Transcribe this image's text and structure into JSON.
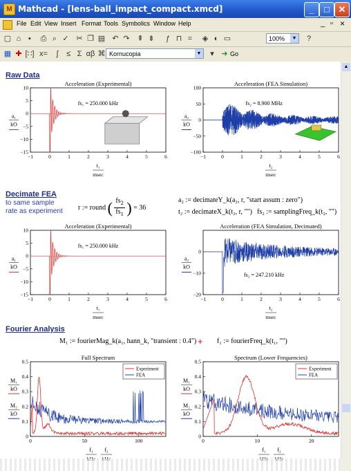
{
  "window": {
    "title": "Mathcad - [lens-ball_impact_compact.xmcd]",
    "minimize": "_",
    "maximize": "□",
    "close": "✕",
    "doc_min": "_",
    "doc_max": "▫",
    "doc_close": "×"
  },
  "menu": [
    "File",
    "Edit",
    "View",
    "Insert",
    "Format",
    "Tools",
    "Symbolics",
    "Window",
    "Help"
  ],
  "toolbar": {
    "zoom": "100%",
    "font": "Kornucopia",
    "go": "Go"
  },
  "sections": {
    "raw": "Raw Data",
    "decimate": "Decimate FEA",
    "decimate_note": [
      "to same sample",
      "rate as experiment"
    ],
    "fourier": "Fourier Analysis"
  },
  "equations": {
    "r": "r := round",
    "r_num": "fs",
    "r_num_sub": "2",
    "r_den": "fs",
    "r_den_sub": "1",
    "r_val": "= 36",
    "a2": "a₂ := decimateY_k(a₂, r, \"start assum : zero\")",
    "t2": "t₂ := decimateX_k(t₂, r, \"\")",
    "fs2": "fs₂ := samplingFreq_k(t₂, \"\")",
    "M1": "M₁ := fourierMag_k(a₁, hann_k, \"transient : 0.4\")",
    "plus": "+",
    "f1": "f₁ := fourierFreq_k(t₁, \"\")"
  },
  "chart_data": [
    {
      "type": "line",
      "title": "Acceleration (Experimental)",
      "ylabel": "a₁ / kO",
      "xlabel": "t₁ / msec",
      "xlim": [
        -1,
        6
      ],
      "ylim": [
        -15,
        10
      ],
      "xticks": [
        "−1",
        "0",
        "1",
        "2",
        "3",
        "4",
        "5",
        "6"
      ],
      "yticks": [
        "10",
        "5",
        "0",
        "−5",
        "−10",
        "−15"
      ],
      "annotation": "fs₁ = 250.000 kHz",
      "series": [
        {
          "color": "#e03030",
          "kind": "experiment_impact"
        }
      ]
    },
    {
      "type": "line",
      "title": "Acceleration (FEA Simulation)",
      "ylabel": "a₂ / kO",
      "xlabel": "t₂ / msec",
      "xlim": [
        -1,
        6
      ],
      "ylim": [
        -100,
        100
      ],
      "xticks": [
        "−1",
        "0",
        "1",
        "2",
        "3",
        "4",
        "5",
        "6"
      ],
      "yticks": [
        "100",
        "50",
        "0",
        "−50",
        "−100"
      ],
      "annotation": "fs₂ = 8.900 MHz",
      "series": [
        {
          "color": "#1f3fa8",
          "kind": "fea_noisy"
        }
      ]
    },
    {
      "type": "line",
      "title": "Acceleration (Experimental)",
      "ylabel": "a₁ / kO",
      "xlabel": "t₁ / msec",
      "xlim": [
        -1,
        6
      ],
      "ylim": [
        -15,
        10
      ],
      "xticks": [
        "−1",
        "0",
        "1",
        "2",
        "3",
        "4",
        "5",
        "6"
      ],
      "yticks": [
        "10",
        "5",
        "0",
        "−5",
        "−10",
        "−15"
      ],
      "annotation": "fs₁ = 250.000 kHz",
      "series": [
        {
          "color": "#e03030",
          "kind": "experiment_impact"
        }
      ]
    },
    {
      "type": "line",
      "title": "Acceleration (FEA Simulation, Decimated)",
      "ylabel": "a₂ / kO",
      "xlabel": "t₂ / msec",
      "xlim": [
        -1,
        6
      ],
      "ylim": [
        -20,
        10
      ],
      "xticks": [
        "−1",
        "0",
        "1",
        "2",
        "3",
        "4",
        "5",
        "6"
      ],
      "yticks": [
        "0",
        "−10",
        "−20"
      ],
      "annotation": "fs₂ = 247.210 kHz",
      "series": [
        {
          "color": "#1f3fa8",
          "kind": "fea_decimated"
        }
      ]
    },
    {
      "type": "line",
      "title": "Full Spectrum",
      "ylabel": "M₁ / kO, M₂ / kO",
      "xlabel": "f₁ / kHz, f₂ / kHz",
      "xlim": [
        0,
        125
      ],
      "ylim": [
        0,
        0.5
      ],
      "xticks": [
        "0",
        "50",
        "100"
      ],
      "yticks": [
        "0.5",
        "0.4",
        "0.3",
        "0.2",
        "0.1",
        "0"
      ],
      "legend": [
        "Experiment",
        "FEA"
      ],
      "legend_position": "top-right",
      "series": [
        {
          "name": "Experiment",
          "color": "#e03030"
        },
        {
          "name": "FEA",
          "color": "#1f3fa8"
        }
      ]
    },
    {
      "type": "line",
      "title": "Spectrum (Lower Frequencies)",
      "ylabel": "M₁ / kO, M₂ / kO",
      "xlabel": "f₁ / kHz, f₂ / kHz",
      "xlim": [
        0,
        25
      ],
      "ylim": [
        0,
        0.5
      ],
      "xticks": [
        "0",
        "10",
        "20"
      ],
      "yticks": [
        "0.5",
        "0.4",
        "0.3",
        "0.2",
        "0.1",
        "0"
      ],
      "legend": [
        "Experiment",
        "FEA"
      ],
      "legend_position": "top-right",
      "series": [
        {
          "name": "Experiment",
          "color": "#e03030"
        },
        {
          "name": "FEA",
          "color": "#1f3fa8"
        }
      ]
    }
  ]
}
